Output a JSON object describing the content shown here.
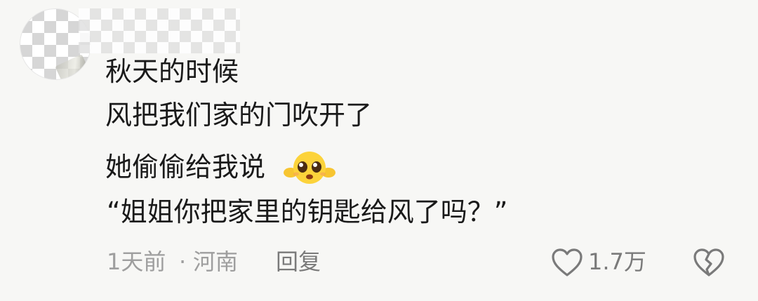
{
  "comment": {
    "lines": [
      "秋天的时候",
      "风把我们家的门吹开了",
      "她偷偷给我说",
      "“姐姐你把家里的钥匙给风了吗？”"
    ],
    "emoji": "pleading-face-emoji"
  },
  "meta": {
    "time": "1天前",
    "separator": "·",
    "location": "河南",
    "reply_label": "回复",
    "like_count": "1.7万"
  },
  "icons": {
    "like": "heart-outline-icon",
    "dislike": "broken-heart-icon"
  },
  "colors": {
    "text": "#1a1a1a",
    "meta": "#9e9e9e",
    "action": "#7a7a7a",
    "background": "#f7f7f5"
  }
}
